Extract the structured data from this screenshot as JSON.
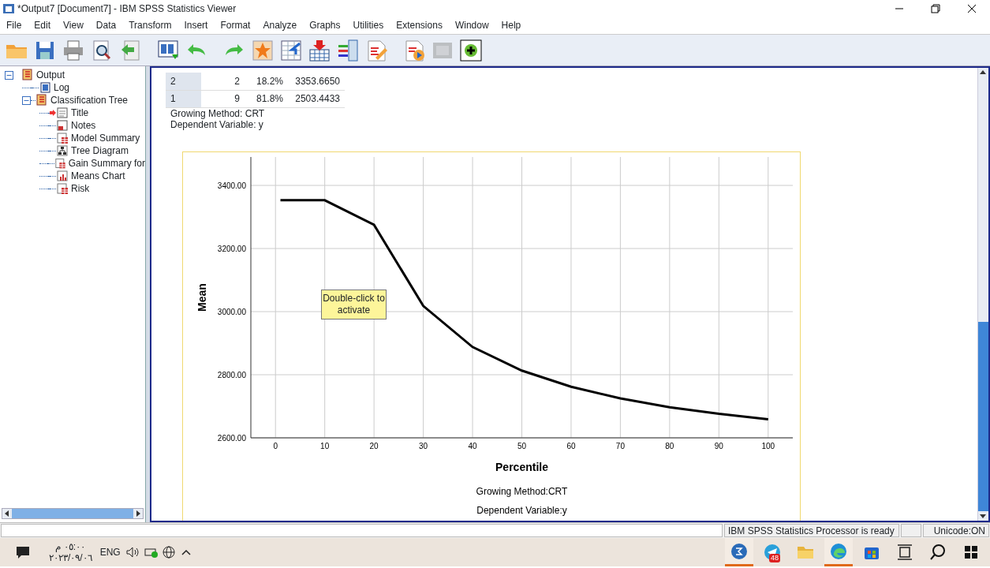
{
  "window": {
    "title": "*Output7 [Document7] - IBM SPSS Statistics Viewer"
  },
  "menu": [
    "File",
    "Edit",
    "View",
    "Data",
    "Transform",
    "Insert",
    "Format",
    "Analyze",
    "Graphs",
    "Utilities",
    "Extensions",
    "Window",
    "Help"
  ],
  "toolbar": [
    {
      "kind": "open",
      "disabled": false
    },
    {
      "kind": "save",
      "disabled": false
    },
    {
      "kind": "print",
      "disabled": false
    },
    {
      "kind": "preview",
      "disabled": false
    },
    {
      "kind": "export",
      "disabled": false
    },
    {
      "kind": "window",
      "disabled": false
    },
    {
      "kind": "undo",
      "disabled": false
    },
    {
      "kind": "redo",
      "disabled": false
    },
    {
      "kind": "star",
      "disabled": false
    },
    {
      "kind": "goto",
      "disabled": false
    },
    {
      "kind": "insert",
      "disabled": false
    },
    {
      "kind": "variables",
      "disabled": false
    },
    {
      "kind": "edit",
      "disabled": false
    },
    {
      "kind": "run",
      "disabled": false
    },
    {
      "kind": "frame",
      "disabled": true
    },
    {
      "kind": "add",
      "disabled": false
    }
  ],
  "outline": [
    {
      "label": "Output",
      "kind": "book",
      "expanded": true,
      "children": [
        {
          "label": "Log",
          "kind": "log",
          "current": false
        },
        {
          "label": "Classification Tree",
          "kind": "book",
          "expanded": true,
          "children": [
            {
              "label": "Title",
              "kind": "title",
              "current": true
            },
            {
              "label": "Notes",
              "kind": "notes",
              "current": false
            },
            {
              "label": "Model Summary",
              "kind": "table",
              "current": false
            },
            {
              "label": "Tree Diagram",
              "kind": "tree",
              "current": false
            },
            {
              "label": "Gain Summary for",
              "kind": "table",
              "current": false
            },
            {
              "label": "Means Chart",
              "kind": "chart",
              "current": false
            },
            {
              "label": "Risk",
              "kind": "table",
              "current": false
            }
          ]
        }
      ]
    }
  ],
  "table": {
    "rows": [
      [
        "2",
        "2",
        "18.2%",
        "3353.6650"
      ],
      [
        "1",
        "9",
        "81.8%",
        "2503.4433"
      ]
    ],
    "footnotes": [
      "Growing Method: CRT",
      "Dependent Variable: y"
    ]
  },
  "chart": {
    "tooltip": "Double-click to activate",
    "footnotes": [
      "Growing Method:CRT",
      "Dependent Variable:y"
    ],
    "chart_data": {
      "type": "line",
      "xlabel": "Percentile",
      "ylabel": "Mean",
      "x": [
        1,
        10,
        20,
        30,
        40,
        50,
        60,
        70,
        80,
        90,
        100
      ],
      "grid": true,
      "series": [
        {
          "color": "#000000",
          "values": [
            3353,
            3353,
            3275,
            3018,
            2888,
            2813,
            2762,
            2725,
            2697,
            2676,
            2659
          ]
        }
      ],
      "xlim": [
        -5,
        105
      ],
      "ylim": [
        2600,
        3490
      ],
      "xticks": [
        0,
        10,
        20,
        30,
        40,
        50,
        60,
        70,
        80,
        90,
        100
      ],
      "yticks": [
        {
          "value": 2600,
          "label": "2600.00"
        },
        {
          "value": 2800,
          "label": "2800.00"
        },
        {
          "value": 3000,
          "label": "3000.00"
        },
        {
          "value": 3200,
          "label": "3200.00"
        },
        {
          "value": 3400,
          "label": "3400.00"
        }
      ]
    }
  },
  "status_bar": [
    "IBM SPSS Statistics Processor is ready",
    "Unicode:ON"
  ],
  "taskbar": {
    "tray": {
      "time": "٠٥:٠٠ م",
      "date": "٢٠٢٣/٠٩/٠٦",
      "language": "ENG"
    },
    "apps": [
      {
        "kind": "spss",
        "running": true
      },
      {
        "kind": "telegram",
        "running": false,
        "badge": "48"
      },
      {
        "kind": "explorer",
        "running": false
      },
      {
        "kind": "edge",
        "running": true
      },
      {
        "kind": "store",
        "running": false
      },
      {
        "kind": "taskview",
        "running": false
      },
      {
        "kind": "search",
        "running": false
      },
      {
        "kind": "start",
        "running": false
      }
    ]
  }
}
